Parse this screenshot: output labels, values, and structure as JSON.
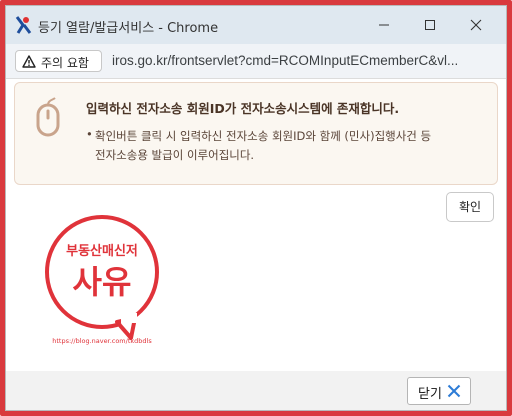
{
  "window": {
    "title": "등기 열람/발급서비스 - Chrome"
  },
  "address_bar": {
    "security_chip_label": "주의 요함",
    "url": "iros.go.kr/frontservlet?cmd=RCOMInputECmemberC&vl..."
  },
  "notice": {
    "title": "입력하신 전자소송 회원ID가 전자소송시스템에 존재합니다.",
    "bullet": "•",
    "description": "확인버튼 클릭 시 입력하신 전자소송 회원ID와 함께 (민사)집행사건 등 전자소송용 발급이 이루어집니다."
  },
  "buttons": {
    "confirm_label": "확인",
    "close_label": "닫기"
  },
  "watermark": {
    "line1": "부동산매신저",
    "line2": "사유",
    "url": "https://blog.naver.com/tkdbdls"
  },
  "colors": {
    "frame_border": "#d93a3e",
    "notice_icon": "#c9a48c",
    "close_x": "#2d7cd6",
    "logo_red": "#e0333a"
  }
}
